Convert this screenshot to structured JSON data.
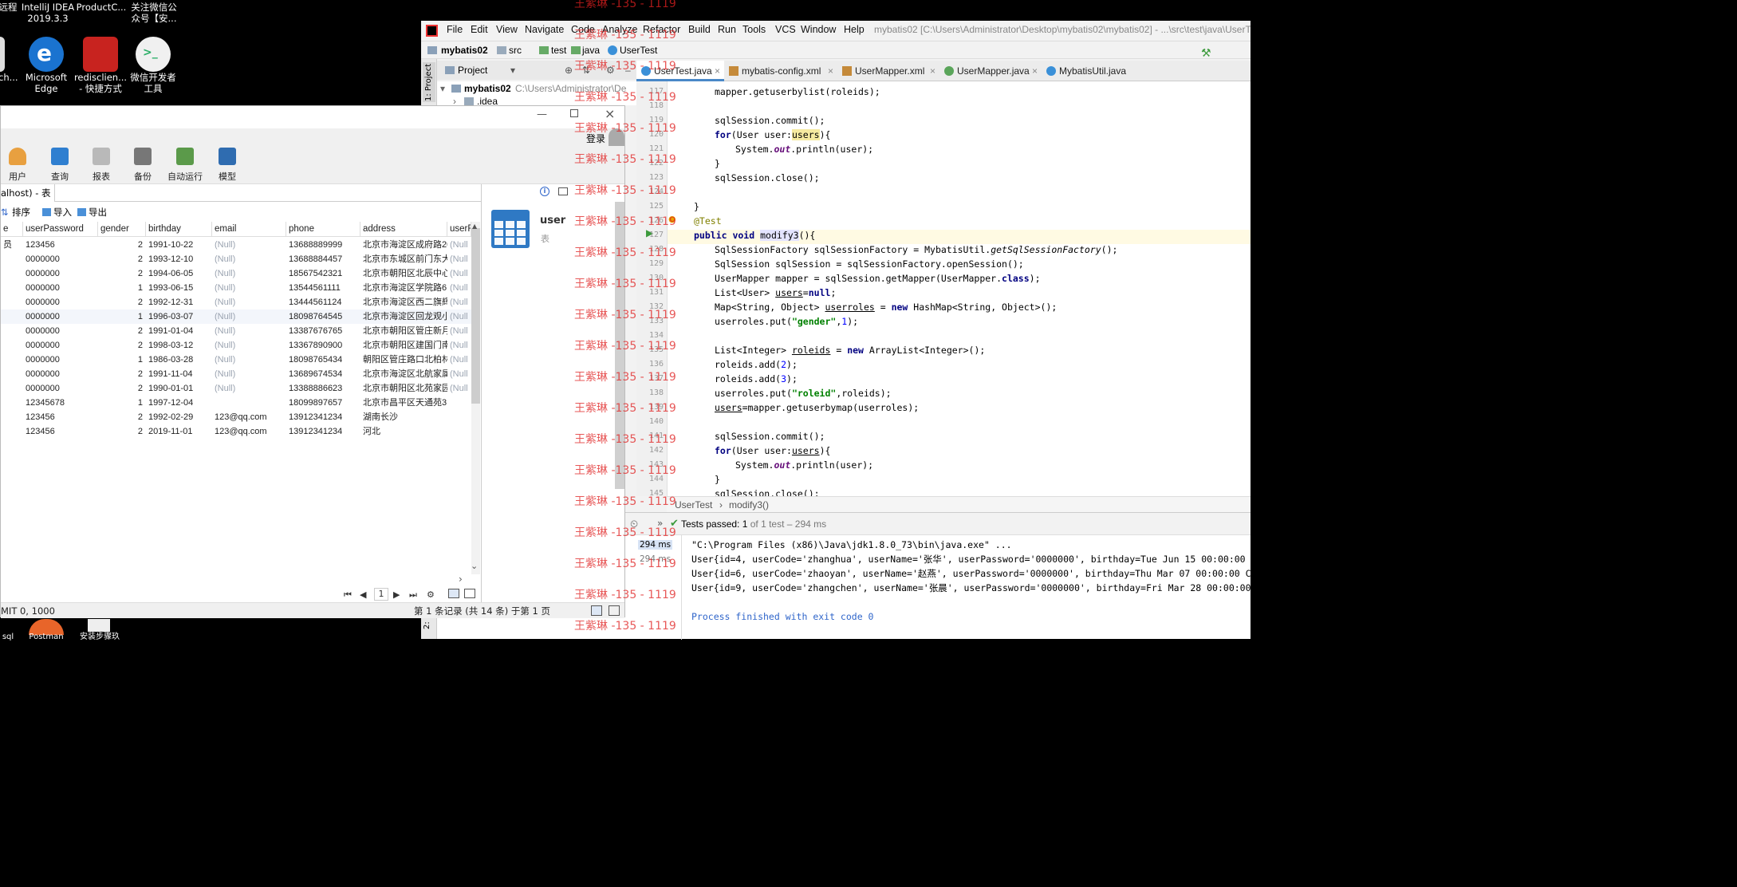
{
  "desktop": {
    "icons": [
      {
        "label1": "远程",
        "label2": "ch..."
      },
      {
        "label1": "IntelliJ IDEA",
        "label2": "2019.3.3"
      },
      {
        "label1": "ProductC...",
        "label2": ""
      },
      {
        "label1": "关注微信公",
        "label2": "众号【安..."
      },
      {
        "label1": "Microsoft",
        "label2": "Edge"
      },
      {
        "label1": "redisclien...",
        "label2": "- 快捷方式"
      },
      {
        "label1": "微信开发者",
        "label2": "工具"
      }
    ],
    "bottom_icons": [
      "sql",
      "Postman",
      "安装步骤玖"
    ]
  },
  "navicat": {
    "login_label": "登录",
    "toolbar": [
      "用户",
      "查询",
      "报表",
      "备份",
      "自动运行",
      "模型"
    ],
    "tab_title": "alhost) - 表",
    "actions": [
      "排序",
      "导入",
      "导出"
    ],
    "columns": [
      "e",
      "userPassword",
      "gender",
      "birthday",
      "email",
      "phone",
      "address",
      "userR"
    ],
    "rows": [
      [
        "员",
        "123456",
        "2",
        "1991-10-22",
        "(Null)",
        "13688889999",
        "北京市海淀区成府路20"
      ],
      [
        "",
        "0000000",
        "2",
        "1993-12-10",
        "(Null)",
        "13688884457",
        "北京市东城区前门东大"
      ],
      [
        "",
        "0000000",
        "2",
        "1994-06-05",
        "(Null)",
        "18567542321",
        "北京市朝阳区北辰中心"
      ],
      [
        "",
        "0000000",
        "1",
        "1993-06-15",
        "(Null)",
        "13544561111",
        "北京市海淀区学院路61"
      ],
      [
        "",
        "0000000",
        "2",
        "1992-12-31",
        "(Null)",
        "13444561124",
        "北京市海淀区西二旗辉"
      ],
      [
        "",
        "0000000",
        "1",
        "1996-03-07",
        "(Null)",
        "18098764545",
        "北京市海淀区回龙观小"
      ],
      [
        "",
        "0000000",
        "2",
        "1991-01-04",
        "(Null)",
        "13387676765",
        "北京市朝阳区管庄新月"
      ],
      [
        "",
        "0000000",
        "2",
        "1998-03-12",
        "(Null)",
        "13367890900",
        "北京市朝阳区建国门南"
      ],
      [
        "",
        "0000000",
        "1",
        "1986-03-28",
        "(Null)",
        "18098765434",
        "朝阳区管庄路口北柏林"
      ],
      [
        "",
        "0000000",
        "2",
        "1991-11-04",
        "(Null)",
        "13689674534",
        "北京市海淀区北航家属"
      ],
      [
        "",
        "0000000",
        "2",
        "1990-01-01",
        "(Null)",
        "13388886623",
        "北京市朝阳区北苑家园"
      ],
      [
        "",
        "12345678",
        "1",
        "1997-12-04",
        "",
        "18099897657",
        "北京市昌平区天通苑3"
      ],
      [
        "",
        "123456",
        "2",
        "1992-02-29",
        "123@qq.com",
        "13912341234",
        "湖南长沙"
      ],
      [
        "",
        "123456",
        "2",
        "2019-11-01",
        "123@qq.com",
        "13912341234",
        "河北"
      ]
    ],
    "last_col_null": "(Null",
    "info_name": "user",
    "info_type": "表",
    "page_number": "1",
    "status_left": "MIT 0, 1000",
    "status_right": "第 1 条记录 (共 14 条) 于第 1 页"
  },
  "intellij": {
    "menu": [
      "File",
      "Edit",
      "View",
      "Navigate",
      "Code",
      "Analyze",
      "Refactor",
      "Build",
      "Run",
      "Tools",
      "VCS",
      "Window",
      "Help"
    ],
    "window_title": "mybatis02 [C:\\Users\\Administrator\\Desktop\\mybatis02\\mybatis02] - ...\\src\\test\\java\\UserT",
    "breadcrumbs": [
      "mybatis02",
      "src",
      "test",
      "java",
      "UserTest"
    ],
    "project_label": "Project",
    "sidebar_label": "1: Project",
    "tree": [
      {
        "name": "mybatis02",
        "path": "C:\\Users\\Administrator\\De"
      },
      {
        "name": ".idea",
        "path": ""
      }
    ],
    "tabs": [
      "UserTest.java",
      "mybatis-config.xml",
      "UserMapper.xml",
      "UserMapper.java",
      "MybatisUtil.java"
    ],
    "line_numbers": [
      "117",
      "118",
      "119",
      "120",
      "121",
      "122",
      "123",
      "124",
      "125",
      "126",
      "127",
      "128",
      "129",
      "130",
      "131",
      "132",
      "133",
      "134",
      "135",
      "136",
      "137",
      "138",
      "139",
      "140",
      "141",
      "142",
      "143",
      "144",
      "145"
    ],
    "code_crumb": [
      "UserTest",
      "modify3()"
    ],
    "test_status": "Tests passed:",
    "test_count": "1",
    "test_detail": "of 1 test – 294 ms",
    "durations": [
      "294 ms",
      "294 ms"
    ],
    "output": [
      "\"C:\\Program Files (x86)\\Java\\jdk1.8.0_73\\bin\\java.exe\" ...",
      "User{id=4, userCode='zhanghua', userName='张华', userPassword='0000000', birthday=Tue Jun 15 00:00:00 CST 1993, g",
      "User{id=6, userCode='zhaoyan', userName='赵燕', userPassword='0000000', birthday=Thu Mar 07 00:00:00 CST 1996, ge",
      "User{id=9, userCode='zhangchen', userName='张晨', userPassword='0000000', birthday=Fri Mar 28 00:00:00 CST 1986,",
      "",
      "Process finished with exit code 0"
    ],
    "bottom_sidebar": "2:"
  },
  "watermark": "王紫琳 -135 - 1119",
  "colors": {
    "accent": "#2f65ca",
    "watermark": "#e02020",
    "pass_green": "#3c9a3c"
  }
}
